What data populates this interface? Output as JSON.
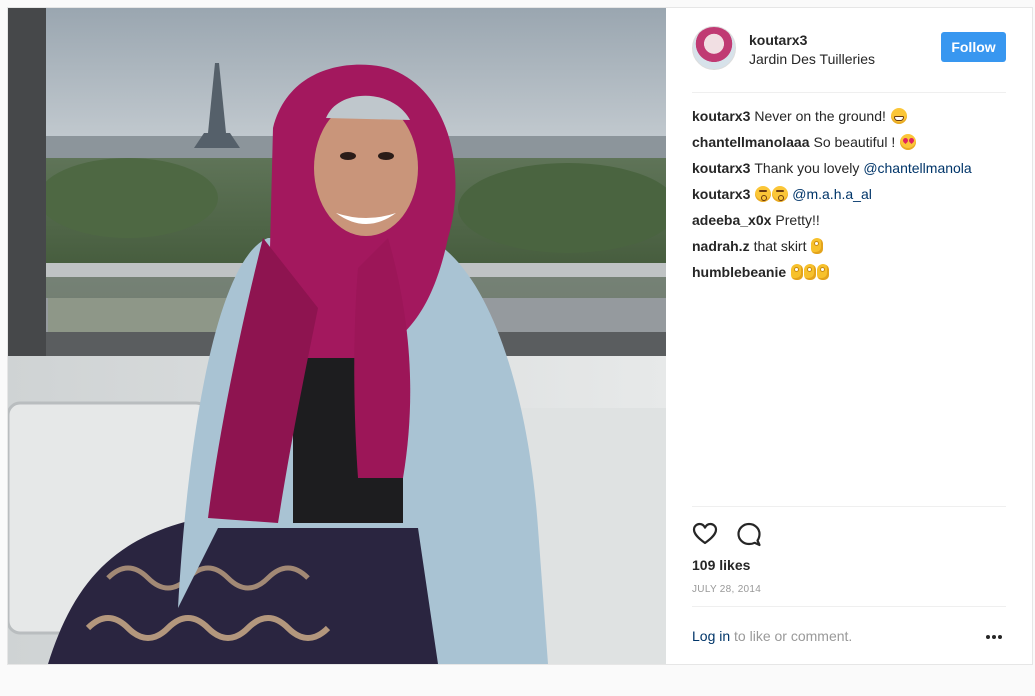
{
  "post": {
    "author": "koutarx3",
    "location": "Jardin Des Tuilleries",
    "follow_label": "Follow",
    "likes": "109 likes",
    "date": "JULY 28, 2014",
    "login_link": "Log in",
    "login_suffix": " to like or comment."
  },
  "comments": [
    {
      "user": "koutarx3",
      "text": "Never on the ground! ",
      "emojis": [
        "grin"
      ]
    },
    {
      "user": "chantellmanolaaa",
      "text": "So beautiful ! ",
      "emojis": [
        "heart-eyes"
      ]
    },
    {
      "user": "koutarx3",
      "text": "Thank you lovely ",
      "mention": "@chantellmanola",
      "emojis": []
    },
    {
      "user": "koutarx3",
      "text": "",
      "emojis_before_mention": [
        "kiss",
        "kiss"
      ],
      "mention": "@m.a.h.a_al"
    },
    {
      "user": "adeeba_x0x",
      "text": "Pretty!!",
      "emojis": []
    },
    {
      "user": "nadrah.z",
      "text": "that skirt ",
      "emojis": [
        "ok"
      ]
    },
    {
      "user": "humblebeanie",
      "text": "",
      "emojis": [
        "ok",
        "ok",
        "ok"
      ]
    }
  ],
  "icons": {
    "like": "heart-icon",
    "comment": "comment-bubble-icon",
    "more": "more-options-icon"
  },
  "colors": {
    "accent": "#3897f0",
    "link": "#003569",
    "scarf": "#a3185e"
  }
}
